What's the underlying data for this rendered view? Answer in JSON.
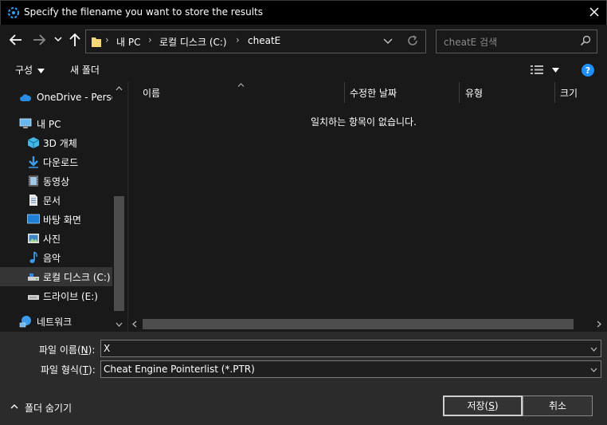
{
  "window": {
    "title": "Specify the filename you want to store the results",
    "close_glyph": "✕"
  },
  "nav": {
    "back_glyph": "←",
    "forward_glyph": "→",
    "recent_glyph": "⌄",
    "up_glyph": "↑"
  },
  "address": {
    "breadcrumbs": [
      "내 PC",
      "로컬 디스크 (C:)",
      "cheatE"
    ],
    "separator": "›"
  },
  "search": {
    "placeholder": "cheatE 검색"
  },
  "toolbar": {
    "organize_label": "구성",
    "new_folder_label": "새 폴더"
  },
  "navpane": {
    "items": [
      {
        "label": "OneDrive - Persoi",
        "icon": "cloud-icon",
        "level": 0
      },
      {
        "label": "내 PC",
        "icon": "computer-icon",
        "level": 0
      },
      {
        "label": "3D 개체",
        "icon": "cube-icon",
        "level": 1
      },
      {
        "label": "다운로드",
        "icon": "download-icon",
        "level": 1
      },
      {
        "label": "동영상",
        "icon": "video-icon",
        "level": 1
      },
      {
        "label": "문서",
        "icon": "document-icon",
        "level": 1
      },
      {
        "label": "바탕 화면",
        "icon": "desktop-icon",
        "level": 1
      },
      {
        "label": "사진",
        "icon": "pictures-icon",
        "level": 1
      },
      {
        "label": "음악",
        "icon": "music-icon",
        "level": 1
      },
      {
        "label": "로컬 디스크 (C:)",
        "icon": "drive-icon",
        "level": 1,
        "selected": true
      },
      {
        "label": "드라이브 (E:)",
        "icon": "drive-icon",
        "level": 1
      },
      {
        "label": "네트워크",
        "icon": "network-icon",
        "level": 0
      }
    ]
  },
  "filelist": {
    "columns": [
      "이름",
      "수정한 날짜",
      "유형",
      "크기"
    ],
    "empty_message": "일치하는 항목이 없습니다."
  },
  "form": {
    "filename_label_prefix": "파일 이름(",
    "filename_label_key": "N",
    "filename_label_suffix": "):",
    "filename_value": "X",
    "filetype_label_prefix": "파일 형식(",
    "filetype_label_key": "T",
    "filetype_label_suffix": "):",
    "filetype_value": "Cheat Engine Pointerlist (*.PTR)",
    "hide_folders_label": "폴더 숨기기",
    "save_label_prefix": "저장(",
    "save_label_key": "S",
    "save_label_suffix": ")",
    "cancel_label": "취소"
  },
  "colors": {
    "accent_blue": "#1e90ff",
    "folder_yellow": "#f7d774",
    "background": "#191919",
    "bottom_panel": "#2b2b2b"
  }
}
